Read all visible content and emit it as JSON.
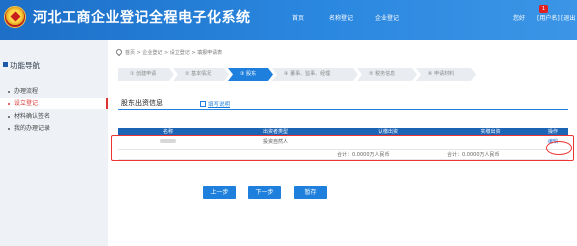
{
  "header": {
    "title": "河北工商企业登记全程电子化系统",
    "nav": [
      "首页",
      "名称登记",
      "企业登记"
    ],
    "greeting": "您好",
    "username": "[用户名]",
    "logout": "[退出",
    "notification_count": "1"
  },
  "sidebar": {
    "title": "功能导航",
    "items": [
      {
        "label": "办理流程"
      },
      {
        "label": "设立登记"
      },
      {
        "label": "材料确认签名"
      },
      {
        "label": "我的办理记录"
      }
    ]
  },
  "breadcrumb": "首页 > 企业登记 > 设立登记 > 填报申请表",
  "steps": [
    {
      "label": "① 创建申请"
    },
    {
      "label": "② 基本情况"
    },
    {
      "label": "③ 股东"
    },
    {
      "label": "④ 董事、监事、经理"
    },
    {
      "label": "⑤ 税务信息"
    },
    {
      "label": "⑥ 申请材料"
    }
  ],
  "tabs": {
    "main": "股东出资信息",
    "help": "填写说明"
  },
  "table": {
    "headers": [
      "名称",
      "出资者类型",
      "认缴出资",
      "实缴出资",
      "操作"
    ],
    "row": {
      "type": "投资自然人",
      "action": "编辑"
    },
    "totals": {
      "subscribed": "合计：0.0000万人民币",
      "paid": "合计：0.0000万人民币"
    }
  },
  "buttons": {
    "prev": "上一步",
    "next": "下一步",
    "save": "暂存"
  },
  "colors": {
    "header_blue": "#1d6fc7",
    "accent_blue": "#1e7fdc",
    "table_header": "#1b63b5",
    "highlight_red": "#e33"
  }
}
